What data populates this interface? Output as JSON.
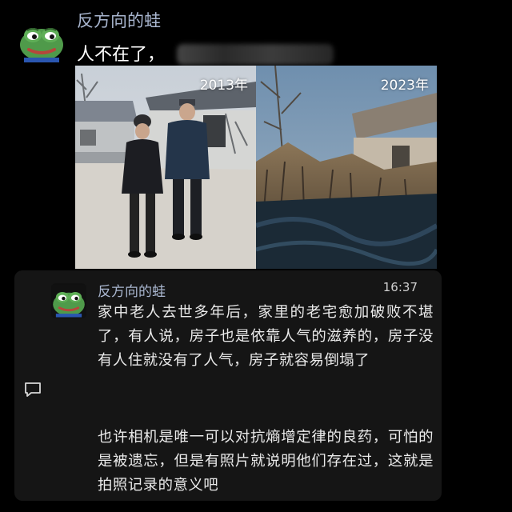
{
  "top_post": {
    "username": "反方向的蛙",
    "message_visible": "人不在了，",
    "avatar_icon": "frog-avatar-icon"
  },
  "photos": [
    {
      "year_label": "2013年"
    },
    {
      "year_label": "2023年"
    }
  ],
  "reply": {
    "username": "反方向的蛙",
    "time": "16:37",
    "paragraph_1": "家中老人去世多年后，家里的老宅愈加破败不堪了，有人说，房子也是依靠人气的滋养的，房子没有人住就没有了人气，房子就容易倒塌了",
    "paragraph_2": "也许相机是唯一可以对抗熵增定律的良药，可怕的是被遗忘，但是有照片就说明他们存在过，这就是拍照记录的意义吧"
  },
  "icons": {
    "comment": "comment-icon"
  },
  "colors": {
    "username": "#a9b6cf",
    "background": "#000000",
    "card": "#151515",
    "frog_green": "#4f9a4a"
  }
}
